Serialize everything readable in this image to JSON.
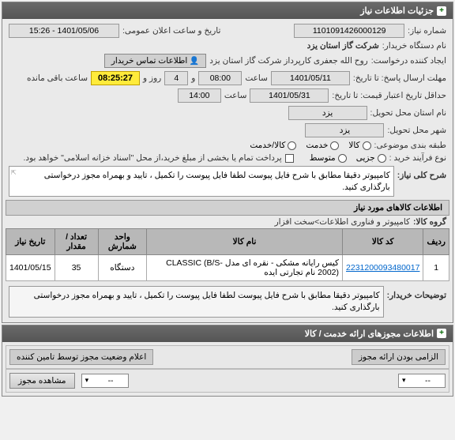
{
  "header": {
    "title": "جزئیات اطلاعات نیاز"
  },
  "form": {
    "need_number_label": "شماره نیاز:",
    "need_number": "1101091426000129",
    "announce_date_label": "تاریخ و ساعت اعلان عمومی:",
    "announce_date": "1401/05/06 - 15:26",
    "buyer_label": "نام دستگاه خریدار:",
    "buyer": "شرکت گاز استان یزد",
    "creator_label": "ایجاد کننده درخواست:",
    "creator": "روح الله جعفری کارپرداز شرکت گاز استان یزد",
    "contact_btn": "اطلاعات تماس خریدار",
    "reply_deadline_label": "مهلت ارسال پاسخ: تا تاریخ:",
    "reply_date": "1401/05/11",
    "time_label": "ساعت",
    "reply_time": "08:00",
    "and_label": "و",
    "day_value": "4",
    "day_label": "روز و",
    "countdown": "08:25:27",
    "remaining_label": "ساعت باقی مانده",
    "validity_label": "حداقل تاریخ اعتبار قیمت: تا تاریخ:",
    "validity_date": "1401/05/31",
    "validity_time": "14:00",
    "province_label": "نام استان محل تحویل:",
    "province": "یزد",
    "city_label": "شهر محل تحویل:",
    "city": "یزد",
    "category_label": "طبقه بندی موضوعی:",
    "cat_goods": "کالا",
    "cat_service": "خدمت",
    "cat_both": "کالا/خدمت",
    "process_label": "نوع فرآیند خرید :",
    "proc_partial": "جزیی",
    "proc_medium": "متوسط",
    "payment_note": "پرداخت تمام یا بخشی از مبلغ خرید،از محل \"اسناد خزانه اسلامی\" خواهد بود.",
    "desc_label": "شرح کلی نیاز:",
    "desc_text": "کامپیوتر دقیقا مطابق با شرح فایل پیوست لطفا فایل پیوست را تکمیل ، تایید و بهمراه مجوز درخواستی بارگذاری کنید."
  },
  "goods": {
    "header": "اطلاعات کالاهای مورد نیاز",
    "group_label": "گروه کالا:",
    "group_value": "کامپیوتر و فناوری اطلاعات>سخت افزار",
    "columns": {
      "row": "ردیف",
      "code": "کد کالا",
      "name": "نام کالا",
      "unit": "واحد شمارش",
      "qty": "تعداد / مقدار",
      "date": "تاریخ نیاز"
    },
    "rows": [
      {
        "idx": "1",
        "code": "2231200093480017",
        "name": "کیس رایانه مشکی - نقره ای مدل CLASSIC (B/S-2002) نام تجارتی ایده",
        "unit": "دستگاه",
        "qty": "35",
        "date": "1401/05/15"
      }
    ],
    "buyer_note_label": "توضیحات خریدار:",
    "buyer_note": "کامپیوتر دقیقا مطابق با شرح فایل پیوست لطفا فایل پیوست را تکمیل ، تایید و بهمراه مجوز درخواستی بارگذاری کنید."
  },
  "permits": {
    "header": "اطلاعات مجوزهای ارائه خدمت / کالا",
    "mandatory_label": "الزامی بودن ارائه مجوز",
    "status_label": "اعلام وضعیت مجوز توسط تامین کننده",
    "select_value": "--",
    "view_btn": "مشاهده مجوز"
  }
}
